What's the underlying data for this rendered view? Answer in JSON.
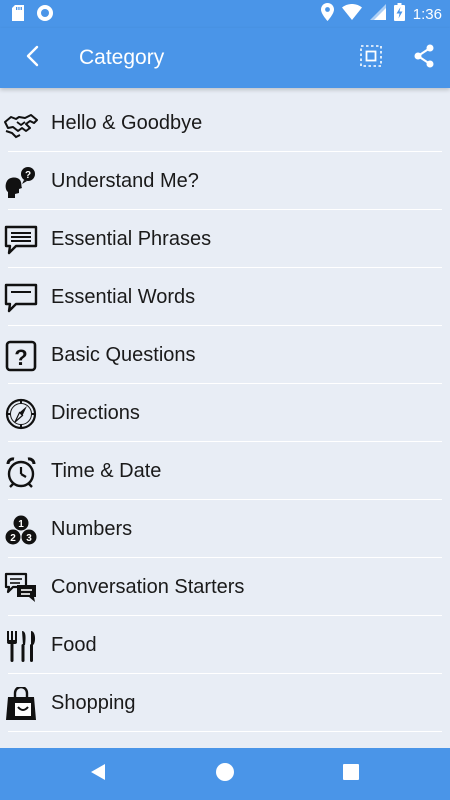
{
  "status_bar": {
    "time": "1:36",
    "left_icons": [
      "sd-card-icon",
      "sync-circle-icon"
    ],
    "right_icons": [
      "location-icon",
      "wifi-icon",
      "signal-icon",
      "battery-charging-icon"
    ]
  },
  "app_bar": {
    "title": "Category",
    "back_icon": "chevron-left-icon",
    "actions": [
      "fullscreen-icon",
      "share-icon"
    ]
  },
  "categories": [
    {
      "label": "Hello & Goodbye",
      "icon": "handshake-icon"
    },
    {
      "label": "Understand Me?",
      "icon": "head-question-icon"
    },
    {
      "label": "Essential Phrases",
      "icon": "speech-bubble-lines-icon"
    },
    {
      "label": "Essential Words",
      "icon": "speech-bubble-line-icon"
    },
    {
      "label": "Basic Questions",
      "icon": "question-box-icon"
    },
    {
      "label": "Directions",
      "icon": "compass-icon"
    },
    {
      "label": "Time & Date",
      "icon": "alarm-clock-icon"
    },
    {
      "label": "Numbers",
      "icon": "numbers-balls-icon"
    },
    {
      "label": "Conversation Starters",
      "icon": "two-bubbles-icon"
    },
    {
      "label": "Food",
      "icon": "fork-knife-icon"
    },
    {
      "label": "Shopping",
      "icon": "shopping-bag-icon"
    }
  ],
  "nav_bar": [
    "back-triangle-icon",
    "home-circle-icon",
    "recents-square-icon"
  ],
  "colors": {
    "primary": "#4a95e8",
    "background": "#e8edf5",
    "divider": "#ffffff",
    "text": "#1a1a1a"
  }
}
